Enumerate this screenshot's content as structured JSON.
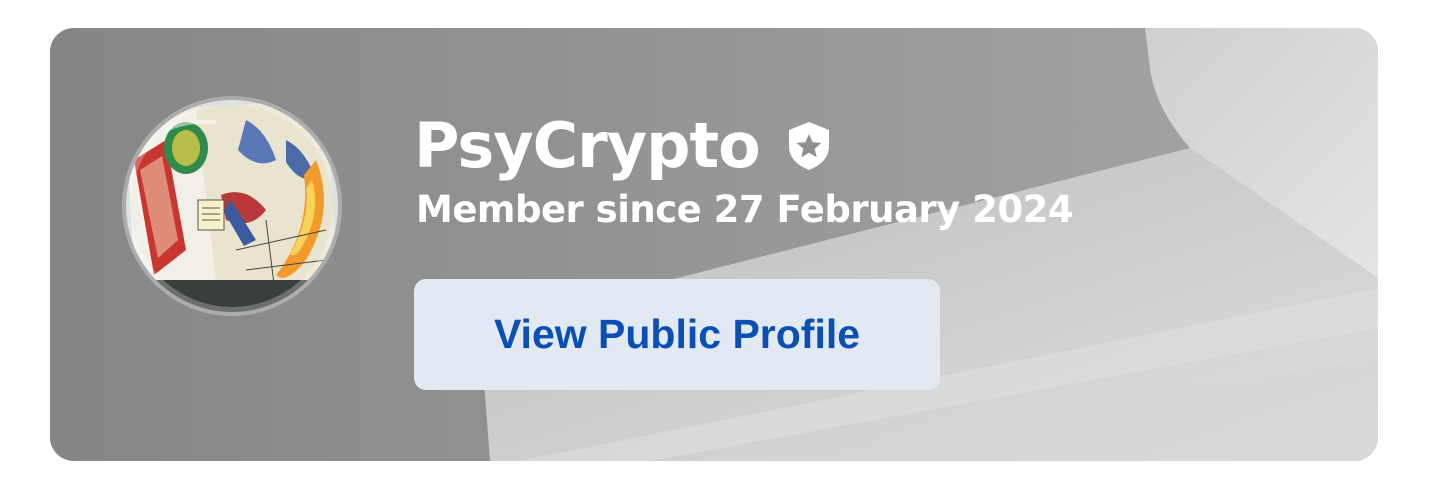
{
  "profile": {
    "username": "PsyCrypto",
    "member_since": "Member since 27 February 2024",
    "verified_icon": "shield-star-icon",
    "avatar": "avatar-comic-book-cover"
  },
  "actions": {
    "view_profile_label": "View Public Profile"
  },
  "colors": {
    "card_background": "#8c8c8c",
    "button_background": "#e2e9f3",
    "button_text": "#0a4fb4",
    "text": "#ffffff"
  }
}
